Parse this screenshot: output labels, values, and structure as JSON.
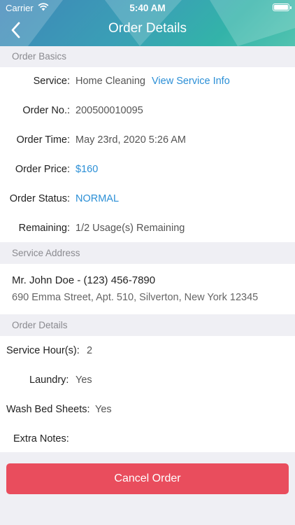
{
  "status_bar": {
    "carrier": "Carrier",
    "time": "5:40 AM"
  },
  "nav": {
    "title": "Order Details",
    "back_icon": "chevron-left-icon"
  },
  "order_basics": {
    "header": "Order Basics",
    "service_label": "Service:",
    "service_value": "Home Cleaning",
    "service_link": "View Service Info",
    "order_no_label": "Order No.:",
    "order_no_value": "200500010095",
    "order_time_label": "Order Time:",
    "order_time_value": "May 23rd, 2020 5:26 AM",
    "order_price_label": "Order Price:",
    "order_price_value": "$160",
    "order_status_label": "Order Status:",
    "order_status_value": "NORMAL",
    "remaining_label": "Remaining:",
    "remaining_value": "1/2 Usage(s) Remaining"
  },
  "service_address": {
    "header": "Service Address",
    "name_phone": "Mr. John Doe - (123) 456-7890",
    "address": "690  Emma Street, Apt. 510, Silverton, New York 12345"
  },
  "order_details": {
    "header": "Order Details",
    "service_hours_label": "Service Hour(s):",
    "service_hours_value": "2",
    "laundry_label": "Laundry:",
    "laundry_value": "Yes",
    "wash_bed_sheets_label": "Wash Bed Sheets:",
    "wash_bed_sheets_value": "Yes",
    "extra_notes_label": "Extra Notes:",
    "extra_notes_value": ""
  },
  "actions": {
    "cancel_label": "Cancel Order"
  },
  "colors": {
    "accent_blue": "#2b8fd6",
    "danger_red": "#e94d5d",
    "header_teal": "#3a9fb6"
  }
}
